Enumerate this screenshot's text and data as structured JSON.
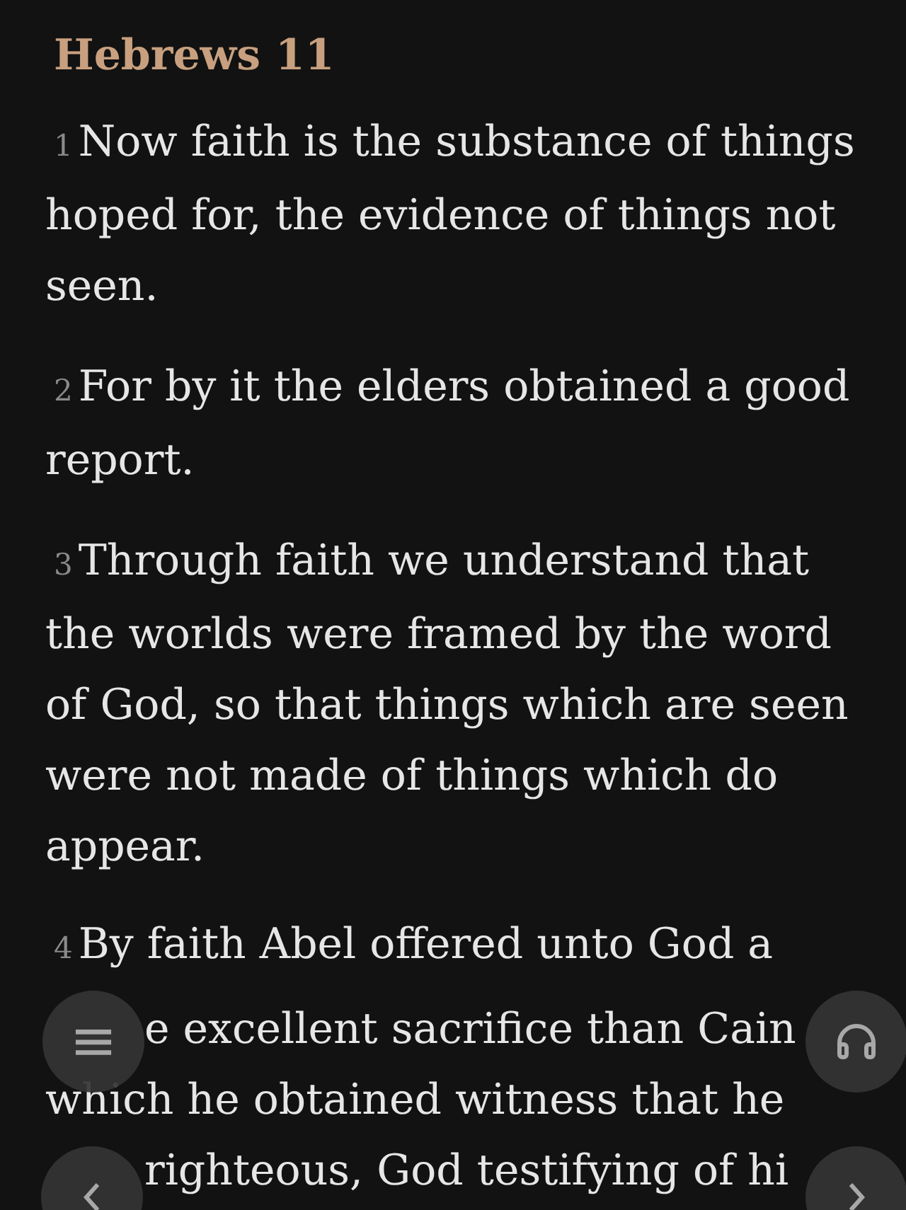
{
  "title": "Hebrews 11",
  "verses": [
    {
      "number": "1",
      "text": "Now faith is the substance of things hoped for, the evidence of things not seen."
    },
    {
      "number": "2",
      "text": "For by it the elders obtained a good report."
    },
    {
      "number": "3",
      "text": "Through faith we understand that the worlds were framed by the word of God, so that things which are seen were not made of things which do appear."
    },
    {
      "number": "4",
      "lines": [
        {
          "text": "By faith Abel offered unto God a"
        },
        {
          "text": "e excellent sacrifice than Cain",
          "covered": true
        },
        {
          "text": "which he obtained witness that he"
        },
        {
          "text": "righteous, God testifying of hi",
          "covered": true
        }
      ]
    }
  ],
  "controls": {
    "menu": "≡"
  }
}
